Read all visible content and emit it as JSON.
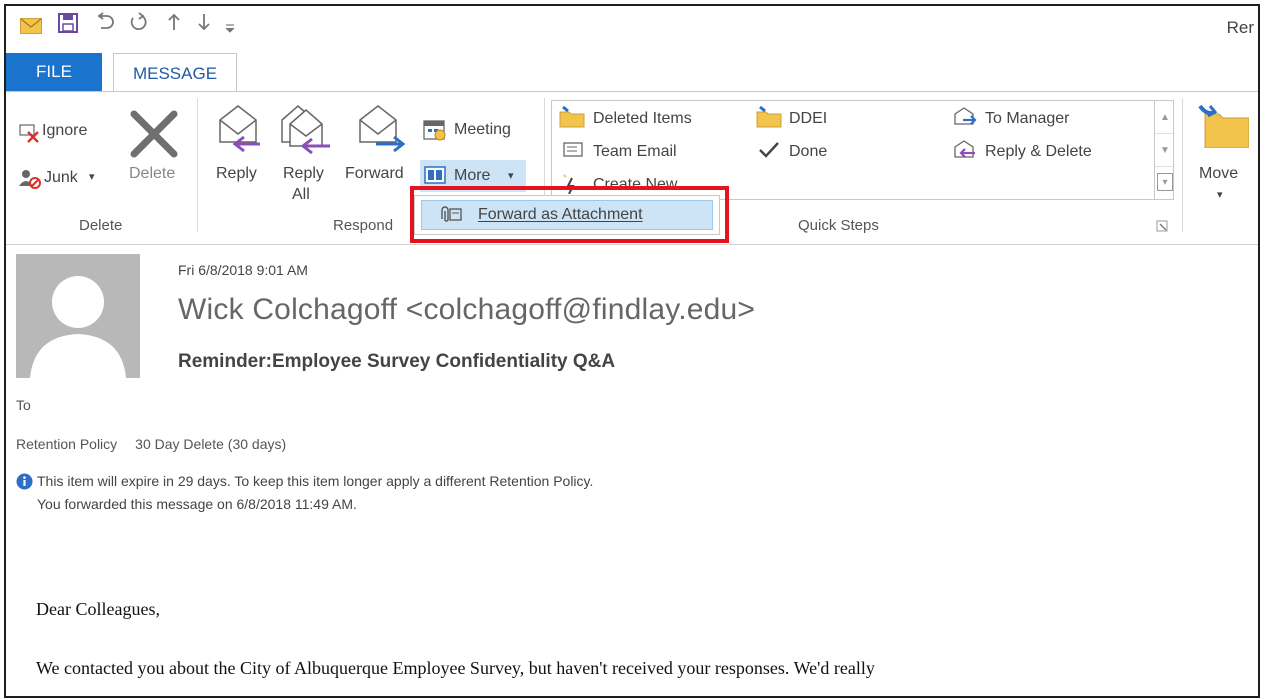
{
  "window": {
    "title_partial": "Rer"
  },
  "tabs": {
    "file": "FILE",
    "message": "MESSAGE"
  },
  "ribbon": {
    "delete_group": {
      "ignore": "Ignore",
      "junk": "Junk",
      "delete": "Delete",
      "label": "Delete"
    },
    "respond_group": {
      "reply": "Reply",
      "reply_all_1": "Reply",
      "reply_all_2": "All",
      "forward": "Forward",
      "meeting": "Meeting",
      "more": "More",
      "label": "Respond"
    },
    "quick_steps": {
      "items": [
        "Deleted Items",
        "DDEI",
        "To Manager",
        "Team Email",
        "Done",
        "Reply & Delete",
        "Create New"
      ],
      "label": "Quick Steps"
    },
    "move_group": {
      "move": "Move"
    }
  },
  "dropdown": {
    "forward_as_attachment": "Forward as Attachment"
  },
  "message": {
    "date": "Fri 6/8/2018 9:01 AM",
    "sender": "Wick Colchagoff <colchagoff@findlay.edu>",
    "subject": "Reminder:Employee Survey Confidentiality Q&A",
    "to_label": "To",
    "retention_label": "Retention Policy",
    "retention_value": "30 Day Delete (30 days)",
    "info_line1": "This item will expire in 29 days. To keep this item longer apply a different Retention Policy.",
    "info_line2": "You forwarded this message on 6/8/2018 11:49 AM.",
    "body_greeting": "Dear Colleagues,",
    "body_line1": "We contacted you about the City of Albuquerque Employee Survey, but haven't received your responses. We'd really"
  },
  "colors": {
    "accent": "#1a73cd",
    "highlight": "#cde4f6",
    "callout": "#e3141d",
    "reply_arrow": "#8a4fb8",
    "forward_arrow": "#2d6fc4"
  },
  "icons": [
    "envelope-icon",
    "save-icon",
    "undo-icon",
    "redo-icon",
    "up-arrow-icon",
    "down-arrow-icon",
    "customize-icon",
    "ignore-icon",
    "junk-icon",
    "delete-x-icon",
    "reply-icon",
    "reply-all-icon",
    "forward-icon",
    "meeting-icon",
    "more-icon",
    "folder-icon",
    "team-email-icon",
    "checkmark-icon",
    "to-manager-icon",
    "reply-delete-icon",
    "create-new-icon",
    "move-icon",
    "attachment-icon",
    "info-icon",
    "avatar"
  ]
}
